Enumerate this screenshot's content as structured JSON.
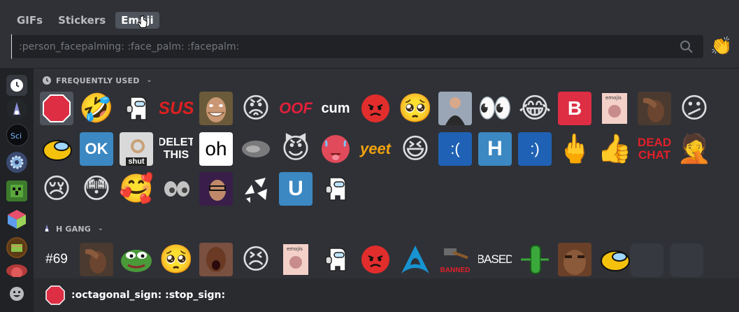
{
  "tabs": [
    {
      "label": "GIFs",
      "active": false
    },
    {
      "label": "Stickers",
      "active": false
    },
    {
      "label": "Emoji",
      "active": true
    }
  ],
  "search": {
    "placeholder": ":person_facepalming: :face_palm: :facepalm:"
  },
  "categories": [
    {
      "label": "FREQUENTLY USED"
    },
    {
      "label": "H GANG"
    }
  ],
  "emoji_text": {
    "sus": "SUS",
    "oof": "OOF",
    "cum": "cum",
    "b": "B",
    "delet": "DELET THIS",
    "shut": "shut",
    "oh": "oh",
    "yeet": "yeet",
    "sad": ":(",
    "h": "H",
    "happy": ":)",
    "dead": "DEAD CHAT",
    "u": "U",
    "n69": "#69",
    "based": "BASED",
    "banned": "BANNED",
    "ok": "OK",
    "emojis": "emojis"
  },
  "footer": {
    "name": ":octagonal_sign: :stop_sign:"
  },
  "colors": {
    "bg": "#2f3136",
    "dark": "#202225",
    "accent": "#5865f2",
    "red": "#dd2e44",
    "blue": "#3b88c3"
  }
}
